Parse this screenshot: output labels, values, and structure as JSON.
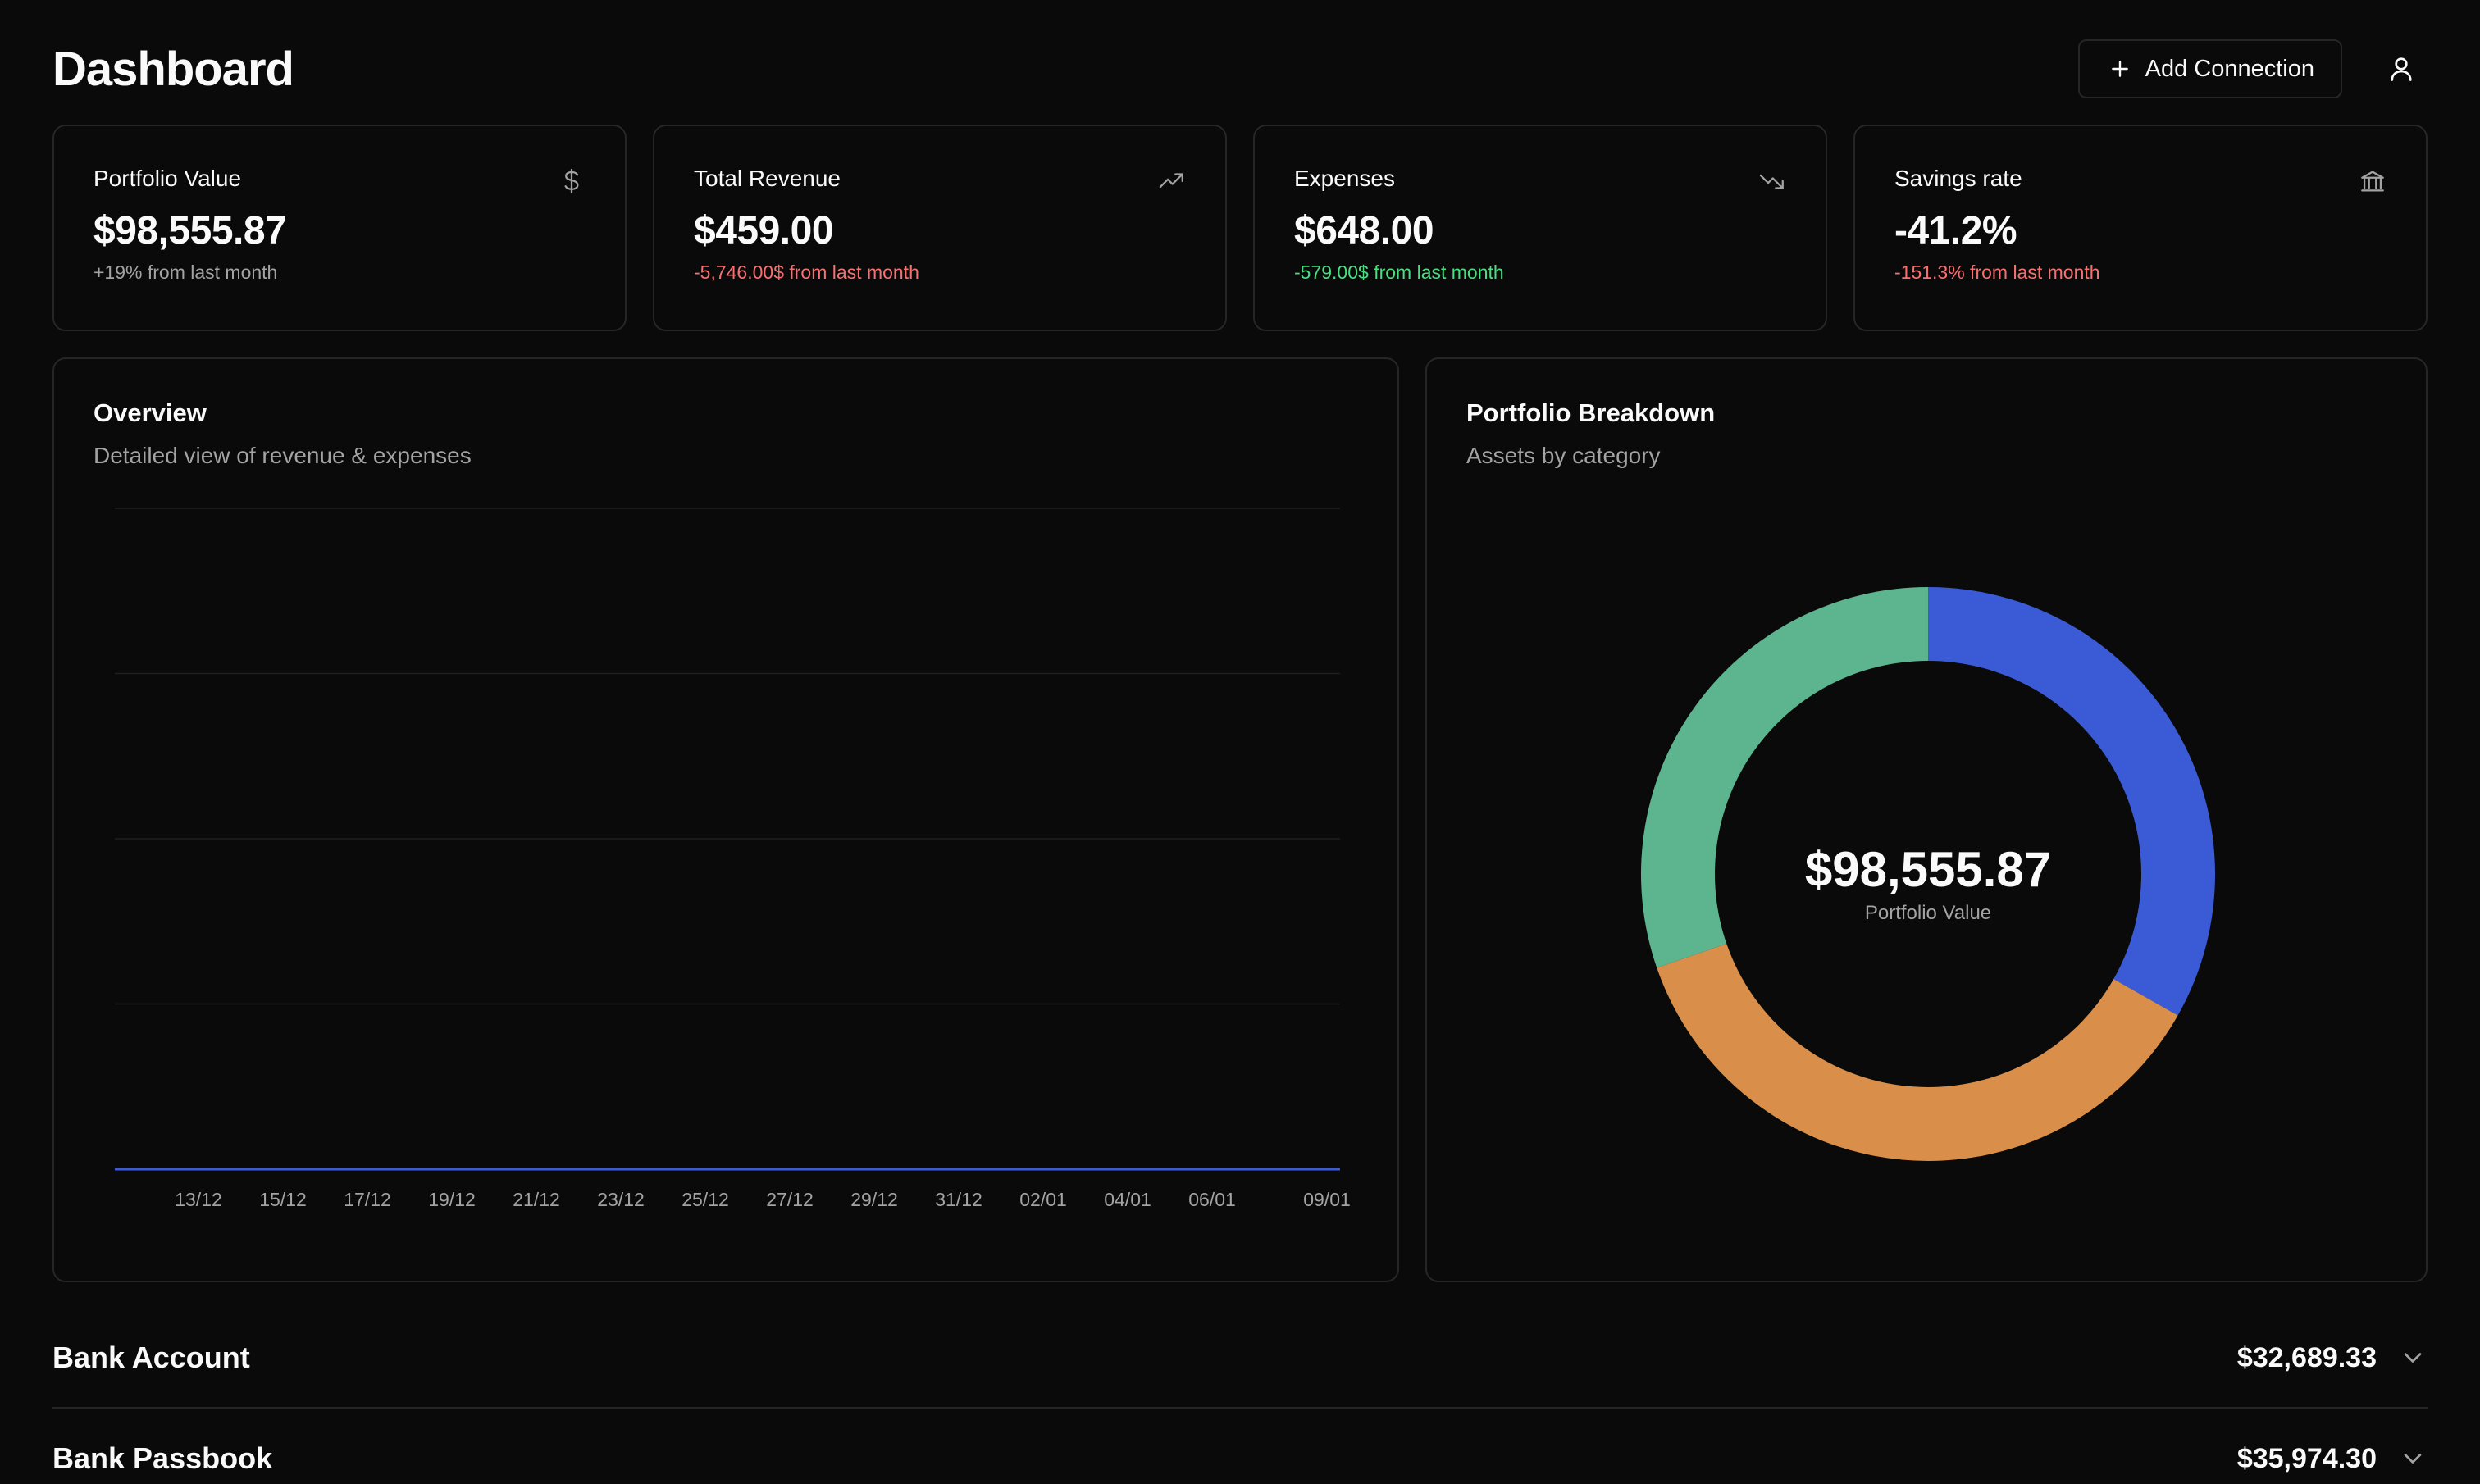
{
  "header": {
    "title": "Dashboard",
    "add_button_label": "Add Connection",
    "add_icon": "plus-icon",
    "user_icon": "user-icon"
  },
  "cards": [
    {
      "label": "Portfolio Value",
      "value": "$98,555.87",
      "delta": "+19% from last month",
      "delta_tone": "neutral",
      "icon": "dollar-icon"
    },
    {
      "label": "Total Revenue",
      "value": "$459.00",
      "delta": "-5,746.00$ from last month",
      "delta_tone": "negative",
      "icon": "trending-up-icon"
    },
    {
      "label": "Expenses",
      "value": "$648.00",
      "delta": "-579.00$ from last month",
      "delta_tone": "positive",
      "icon": "trending-down-icon"
    },
    {
      "label": "Savings rate",
      "value": "-41.2%",
      "delta": "-151.3% from last month",
      "delta_tone": "negative",
      "icon": "bank-icon"
    }
  ],
  "overview": {
    "title": "Overview",
    "subtitle": "Detailed view of revenue & expenses"
  },
  "portfolio": {
    "title": "Portfolio Breakdown",
    "subtitle": "Assets by category",
    "center_value": "$98,555.87",
    "center_label": "Portfolio Value"
  },
  "accounts": [
    {
      "name": "Bank Account",
      "amount": "$32,689.33"
    },
    {
      "name": "Bank Passbook",
      "amount": "$35,974.30"
    }
  ],
  "colors": {
    "background": "#0a0a0a",
    "border": "#262626",
    "negative": "#f87171",
    "positive": "#4ade80",
    "series_line": "#3b5bdb",
    "donut_blue": "#3b5bd6",
    "donut_orange": "#d98f4a",
    "donut_green": "#5db590"
  },
  "chart_data": [
    {
      "type": "line",
      "title": "Overview",
      "x": [
        "13/12",
        "15/12",
        "17/12",
        "19/12",
        "21/12",
        "23/12",
        "25/12",
        "27/12",
        "29/12",
        "31/12",
        "02/01",
        "04/01",
        "06/01",
        "09/01"
      ],
      "series": [
        {
          "values": [
            0,
            0,
            0,
            0,
            0,
            0,
            0,
            0,
            0,
            0,
            0,
            0,
            0,
            0
          ]
        }
      ],
      "grid": true,
      "gridlines": 5
    },
    {
      "type": "pie",
      "title": "Portfolio Breakdown",
      "donut": true,
      "slices": [
        {
          "value": 33.2,
          "color": "#3b5bd6"
        },
        {
          "value": 36.5,
          "color": "#d98f4a"
        },
        {
          "value": 30.3,
          "color": "#5db590"
        }
      ]
    }
  ]
}
